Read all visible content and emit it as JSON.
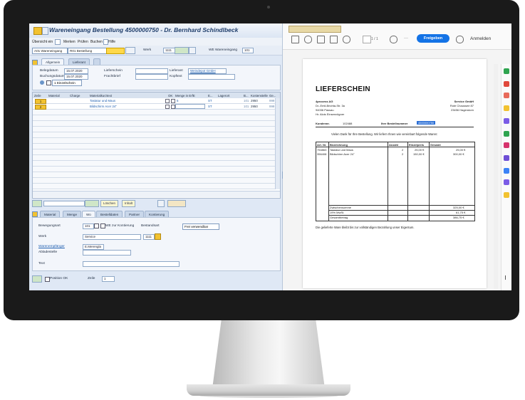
{
  "sap": {
    "window_title": "Wareneingang Bestellung 4500000750 - Dr. Bernhard Schindlbeck",
    "menu": [
      "Übersicht ein",
      "Merken",
      "Prüfen",
      "Buchen",
      "Hilfe"
    ],
    "toolbar": {
      "action_select": "A01 Wareneingang",
      "reference_select": "R01 Bestellung",
      "werk_label": "Werk",
      "werk_value": "1111",
      "movement_label": "WE Wareneingang",
      "movement_value": "101"
    },
    "header_tabs": [
      "Allgemein",
      "Lieferant"
    ],
    "header": {
      "belegdatum_label": "Belegdatum",
      "belegdatum_value": "15.07.2020",
      "buchungsdatum_label": "Buchungsdatum",
      "buchungsdatum_value": "15.07.2020",
      "lieferschein_label": "Lieferschein",
      "frachtbrief_label": "Frachtbrief",
      "lieferant_label": "Lieferant",
      "lieferant_value": "Weindepot GmbH",
      "kopftext_label": "Kopftext",
      "einzelschein": "1 Einzelschein"
    },
    "table": {
      "columns": [
        "Zeile",
        "Material",
        "Charge",
        "Materialkurztext",
        "",
        "OK",
        "Menge in ErfE",
        "E...",
        "Lagerort",
        "B...",
        "Kostenstelle",
        "Ge..."
      ],
      "rows": [
        {
          "zeile": "1",
          "kurztext": "Tastatur und Maus",
          "menge": "5",
          "einheit": "ST",
          "bwa": "101",
          "kostenstelle": "2950",
          "ge": "999"
        },
        {
          "zeile": "2",
          "kurztext": "Bildschirm Acer 24\"",
          "menge": "",
          "einheit": "ST",
          "bwa": "101",
          "kostenstelle": "2950",
          "ge": "999"
        }
      ]
    },
    "buttons": {
      "loeschen": "Löschen",
      "inhalt": "Inhalt"
    },
    "item_tabs": [
      "Material",
      "Menge",
      "Wo",
      "Bestelldaten",
      "Partner",
      "Kontierung"
    ],
    "item": {
      "bewegungsart_label": "Bewegungsart",
      "bewegungsart_value": "101",
      "kontierung_value": "WE zur Kontierung",
      "bestandsart_label": "Bestandsart",
      "bestandsart_value": "Frei verwendbar",
      "werk_label": "Werk",
      "werk_name": "Service",
      "werk_code": "1111",
      "empfaenger_label": "Warenempfänger",
      "empfaenger_value": "E.Merengla",
      "abladestelle_label": "Abladestelle",
      "text_label": "Text"
    },
    "footer": {
      "position_ok": "Position OK",
      "zeile_label": "Zeile",
      "zeile_value": "1"
    }
  },
  "adobe": {
    "page_indicator": "1 / 1",
    "share_button": "Freigeben",
    "signin": "Anmelden",
    "more": "···",
    "pdf": {
      "title": "LIEFERSCHEIN",
      "sender": [
        "4process AG",
        "Dr.-Emil-Brichta-Str. 3a",
        "94036 Passau",
        "Hr. Alois Einsenvögner"
      ],
      "recipient": [
        "Service GmbH",
        "Rote Chaussee 87",
        "23456 Hagendorn"
      ],
      "kundennr_label": "Kundennr.",
      "kundennr_value": "102488",
      "bestellnr_label": "Ihre Bestellnummer",
      "bestellnr_value": "4500000750",
      "intro": "Vielen Dank für Ihre Bestellung. Wir liefern Ihnen wie vereinbart folgende Waren:",
      "columns": [
        "Art. Nr.",
        "Bezeichnung",
        "Anzahl",
        "Einzelpreis",
        "Gesamt"
      ],
      "rows": [
        {
          "nr": "754863",
          "bez": "Tastatur und Maus",
          "anz": "2",
          "ep": "25,00 €",
          "ges": "25,00 €"
        },
        {
          "nr": "356408",
          "bez": "Bildschirm Acer 24\"",
          "anz": "2",
          "ep": "150,00 €",
          "ges": "300,00 €"
        }
      ],
      "totals": [
        {
          "label": "Zwischensumme",
          "value": "325,00 €"
        },
        {
          "label": "19% MwSt.",
          "value": "61,75 €"
        },
        {
          "label": "Gesamtbetrag",
          "value": "386,75 €"
        }
      ],
      "footer_note": "Die gelieferte Ware bleibt bis zur vollständigen Bezahlung unser Eigentum."
    }
  }
}
